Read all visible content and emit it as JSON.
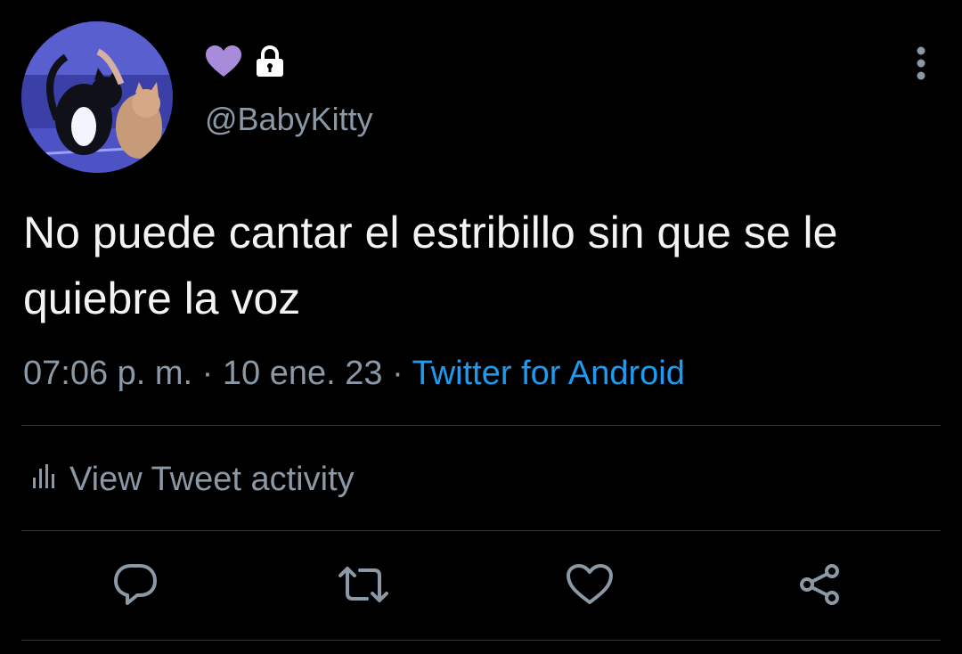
{
  "user": {
    "handle": "@BabyKitty",
    "name_icons": [
      "purple-heart-icon",
      "lock-icon"
    ]
  },
  "tweet": {
    "text": "No puede cantar el estribillo sin que se le quiebre la voz",
    "time": "07:06 p. m.",
    "separator": " · ",
    "date": "10 ene. 23",
    "source": "Twitter for Android"
  },
  "activity": {
    "label": "View Tweet activity",
    "icon": "bar-chart-icon"
  },
  "actions": [
    "reply-icon",
    "retweet-icon",
    "like-icon",
    "share-icon"
  ],
  "colors": {
    "background": "#000000",
    "text": "#f2f3f4",
    "secondary": "#8b98a5",
    "link": "#1d9bf0",
    "heart": "#a98bdc",
    "divider": "#2f3336"
  }
}
